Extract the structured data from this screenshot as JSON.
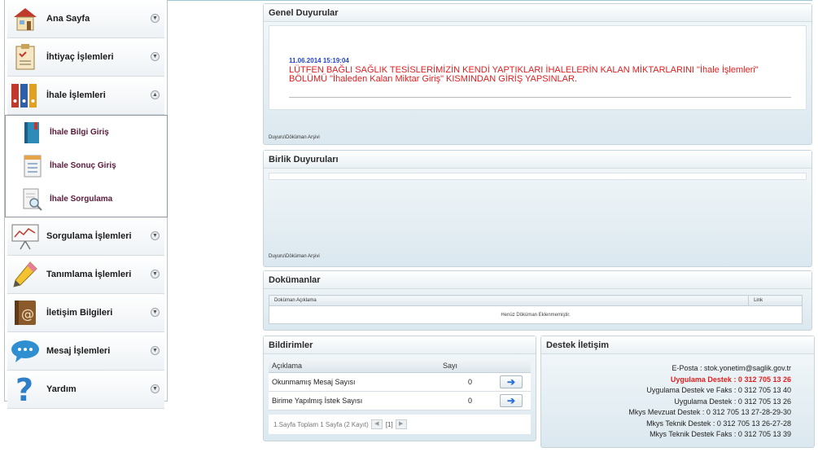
{
  "sidebar": {
    "items": [
      {
        "label": "Ana Sayfa",
        "icon": "house-icon"
      },
      {
        "label": "İhtiyaç İşlemleri",
        "icon": "clipboard-icon"
      },
      {
        "label": "İhale İşlemleri",
        "icon": "binders-icon"
      },
      {
        "label": "Sorgulama İşlemleri",
        "icon": "chart-easel-icon"
      },
      {
        "label": "Tanımlama İşlemleri",
        "icon": "pencil-icon"
      },
      {
        "label": "İletişim Bilgileri",
        "icon": "address-book-icon"
      },
      {
        "label": "Mesaj İşlemleri",
        "icon": "chat-bubble-icon"
      },
      {
        "label": "Yardım",
        "icon": "question-icon"
      }
    ],
    "sub_items": [
      {
        "label": "İhale Bilgi Giriş"
      },
      {
        "label": "İhale Sonuç Giriş"
      },
      {
        "label": "İhale Sorgulama"
      }
    ]
  },
  "genel": {
    "title": "Genel Duyurular",
    "date": "11.06.2014 15:19:04",
    "message": "LÜTFEN BAĞLI SAĞLIK TESİSLERİMİZİN KENDİ YAPTIKLARI İHALELERİN KALAN MİKTARLARINI \"İhale İşlemleri\" BÖLÜMÜ \"İhaleden Kalan Miktar Giriş\" KISMINDAN GİRİŞ YAPSINLAR.",
    "archive": "Duyuru\\Döküman Arşivi"
  },
  "birlik": {
    "title": "Birlik Duyuruları",
    "archive": "Duyuru\\Döküman Arşivi"
  },
  "dokumanlar": {
    "title": "Dokümanlar",
    "col_desc": "Doküman Açıklama",
    "col_link": "Link",
    "empty": "Henüz Döküman Eklenmemiştir."
  },
  "bildirimler": {
    "title": "Bildirimler",
    "col_desc": "Açıklama",
    "col_count": "Sayı",
    "rows": [
      {
        "label": "Okunmamış Mesaj Sayısı",
        "count": "0"
      },
      {
        "label": "Birime Yapılmış İstek Sayısı",
        "count": "0"
      }
    ],
    "pager_text": "1.Sayfa Toplam 1 Sayfa (2 Kayıt)",
    "page_num": "[1]"
  },
  "destek": {
    "title": "Destek İletişim",
    "lines": [
      "E-Posta : stok.yonetim@saglik.gov.tr",
      "Uygulama Destek : 0 312 705 13 26",
      "Uygulama Destek ve Faks : 0 312 705 13 40",
      "Uygulama Destek : 0 312 705 13 26",
      "Mkys Mevzuat Destek : 0 312 705 13 27-28-29-30",
      "Mkys Teknik Destek : 0 312 705 13 26-27-28",
      "Mkys Teknik Destek Faks : 0 312 705 13 39"
    ]
  },
  "colors": {
    "accent_red": "#e01e1e",
    "date_blue": "#2244cc"
  }
}
